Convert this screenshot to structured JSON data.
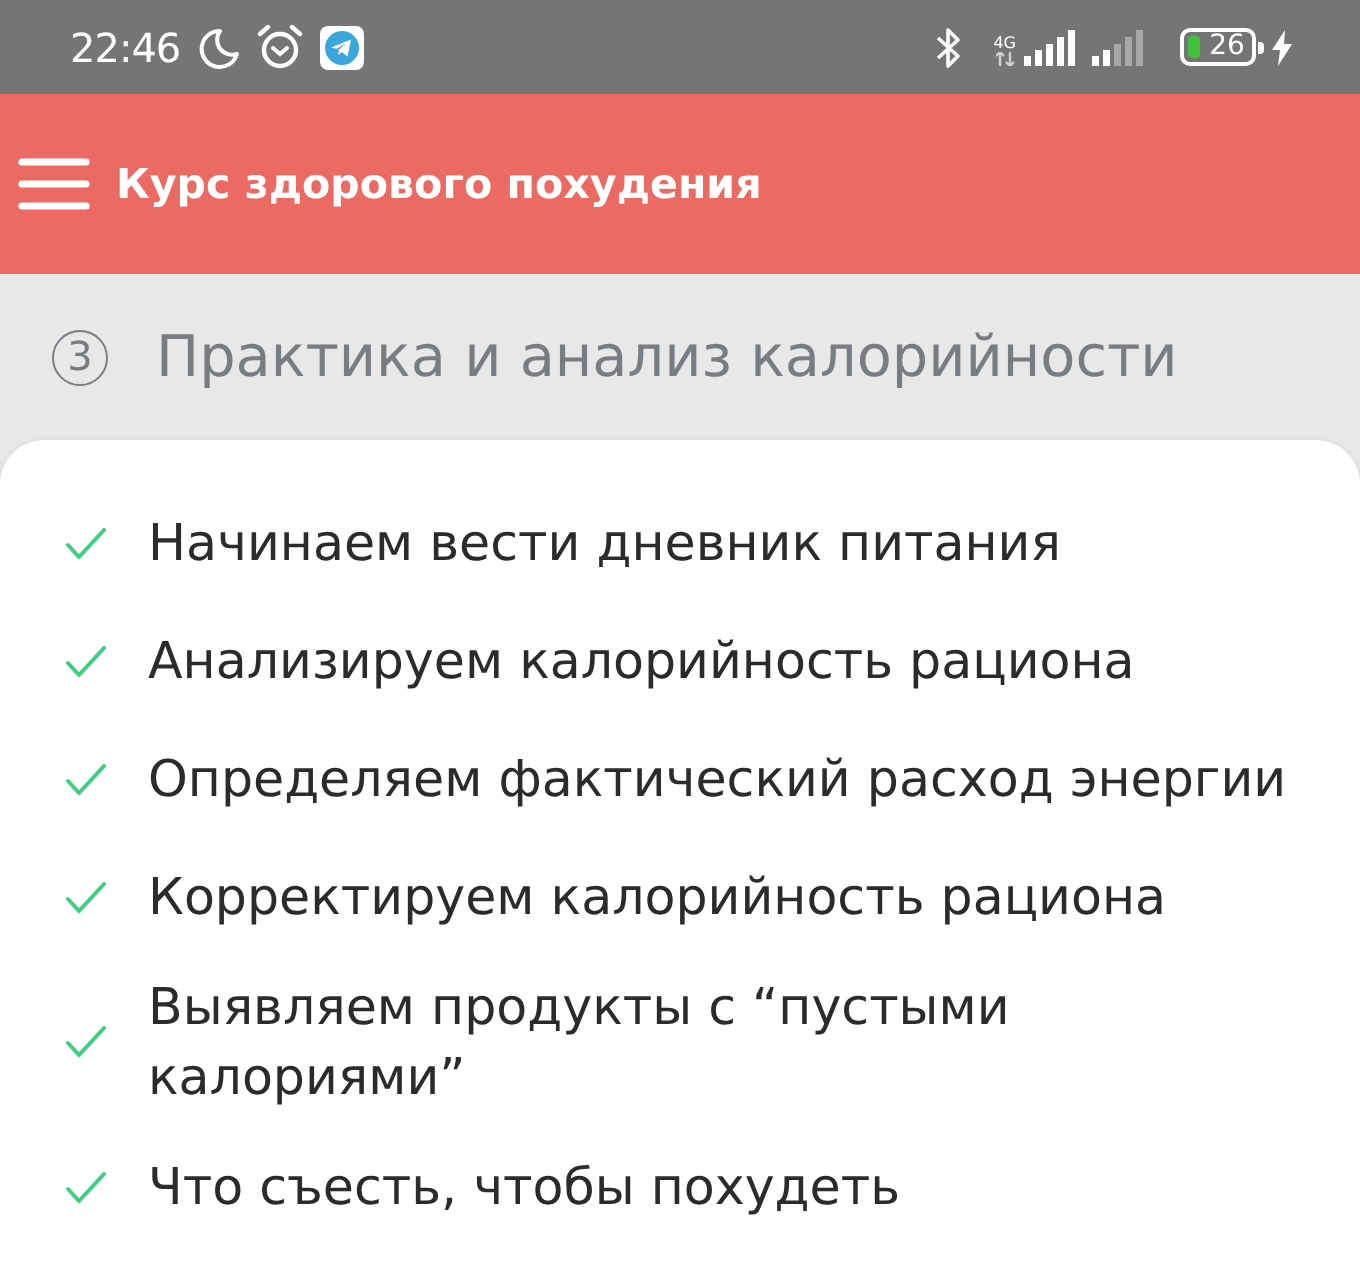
{
  "status_bar": {
    "time": "22:46",
    "network_type": "4G",
    "battery": "26"
  },
  "app_bar": {
    "title": "Курс здорового похудения"
  },
  "section": {
    "number": "3",
    "title": "Практика и анализ калорийности"
  },
  "items": [
    {
      "text": "Начинаем вести дневник питания",
      "checked": true
    },
    {
      "text": "Анализируем калорийность рациона",
      "checked": true
    },
    {
      "text": "Определяем фактический расход энергии",
      "checked": true
    },
    {
      "text": "Корректируем калорийность рациона",
      "checked": true
    },
    {
      "text": "Выявляем продукты с “пустыми калориями”",
      "checked": true
    },
    {
      "text": "Что съесть, чтобы похудеть",
      "checked": true
    }
  ]
}
